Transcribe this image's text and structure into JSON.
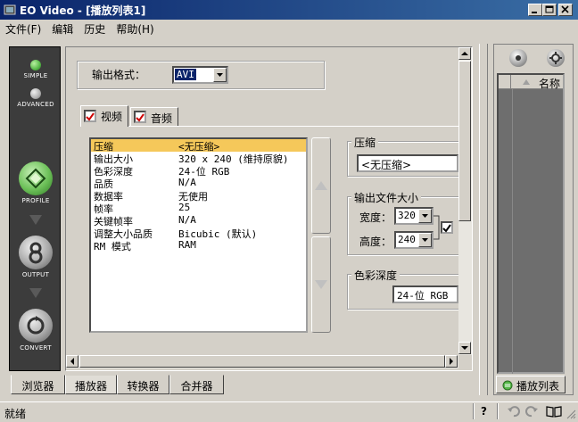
{
  "window": {
    "title": "EO Video - [播放列表1]"
  },
  "menu": [
    "文件(F)",
    "编辑",
    "历史",
    "帮助(H)"
  ],
  "nav": {
    "simple": "SIMPLE",
    "advanced": "ADVANCED",
    "profile": "PROFILE",
    "output": "OUTPUT",
    "convert": "CONVERT"
  },
  "output_format": {
    "label": "输出格式：",
    "value": "AVI"
  },
  "tabs": {
    "video": "视频",
    "audio": "音频"
  },
  "properties": [
    {
      "key": "压缩",
      "value": "<无压缩>"
    },
    {
      "key": "输出大小",
      "value": "320 x 240 (维持原貌)"
    },
    {
      "key": "色彩深度",
      "value": "24-位 RGB"
    },
    {
      "key": "品质",
      "value": "N/A"
    },
    {
      "key": "数据率",
      "value": "无使用"
    },
    {
      "key": "帧率",
      "value": "25"
    },
    {
      "key": "关键帧率",
      "value": "N/A"
    },
    {
      "key": "调整大小品质",
      "value": "Bicubic (默认)"
    },
    {
      "key": "RM 模式",
      "value": "RAM"
    }
  ],
  "compression": {
    "label": "压缩",
    "value": "<无压缩>"
  },
  "output_size": {
    "label": "输出文件大小",
    "width_label": "宽度：",
    "width_value": "320",
    "height_label": "高度：",
    "height_value": "240"
  },
  "color_depth": {
    "label": "色彩深度",
    "value": "24-位 RGB"
  },
  "bottom_tabs": [
    "浏览器",
    "播放器",
    "转换器",
    "合并器"
  ],
  "playlist": {
    "column_name": "名称",
    "tab_label": "播放列表"
  },
  "status": {
    "text": "就绪",
    "help": "?"
  },
  "colors": {
    "titlebar_start": "#0a246a",
    "titlebar_end": "#3a6ea5",
    "selection": "#f5c85a",
    "nav_bg": "#3c3c3c",
    "nav_green": "#56b848",
    "playlist_bg": "#6e6e6e",
    "checkmark": "#cc0000"
  }
}
